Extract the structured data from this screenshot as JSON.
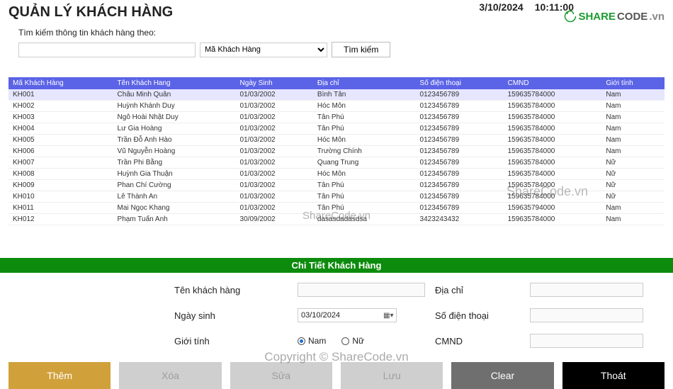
{
  "header": {
    "title": "QUẢN LÝ KHÁCH HÀNG",
    "date": "3/10/2024",
    "time": "10:11:00",
    "logo_share": "SHARE",
    "logo_code": "CODE",
    "logo_vn": ".vn"
  },
  "search": {
    "label": "Tìm kiếm thông tin khách hàng theo:",
    "filter_option": "Mã Khách Hàng",
    "button": "Tìm kiếm"
  },
  "table": {
    "headers": [
      "Mã Khách Hàng",
      "Tên Khách Hang",
      "Ngày Sinh",
      "Địa chỉ",
      "Số điện thoại",
      "CMND",
      "Giới tính"
    ],
    "rows": [
      {
        "id": "KH001",
        "name": "Châu Minh Quân",
        "dob": "01/03/2002",
        "addr": "Bình Tân",
        "phone": "0123456789",
        "cmnd": "159635784000",
        "sex": "Nam",
        "selected": true
      },
      {
        "id": "KH002",
        "name": "Huỳnh Khánh Duy",
        "dob": "01/03/2002",
        "addr": "Hóc Môn",
        "phone": "0123456789",
        "cmnd": "159635784000",
        "sex": "Nam"
      },
      {
        "id": "KH003",
        "name": "Ngô Hoài Nhật Duy",
        "dob": "01/03/2002",
        "addr": "Tân Phú",
        "phone": "0123456789",
        "cmnd": "159635784000",
        "sex": "Nam"
      },
      {
        "id": "KH004",
        "name": "Lư Gia Hoàng",
        "dob": "01/03/2002",
        "addr": "Tân Phú",
        "phone": "0123456789",
        "cmnd": "159635784000",
        "sex": "Nam"
      },
      {
        "id": "KH005",
        "name": "Trần Đỗ Anh Hào",
        "dob": "01/03/2002",
        "addr": "Hóc Môn",
        "phone": "0123456789",
        "cmnd": "159635784000",
        "sex": "Nam"
      },
      {
        "id": "KH006",
        "name": "Vũ Nguyễn Hoàng",
        "dob": "01/03/2002",
        "addr": "Trường Chính",
        "phone": "0123456789",
        "cmnd": "159635784000",
        "sex": "Nam"
      },
      {
        "id": "KH007",
        "name": "Trần Phi Bằng",
        "dob": "01/03/2002",
        "addr": "Quang Trung",
        "phone": "0123456789",
        "cmnd": "159635784000",
        "sex": "Nữ"
      },
      {
        "id": "KH008",
        "name": "Huỳnh Gia Thuận",
        "dob": "01/03/2002",
        "addr": "Hóc Môn",
        "phone": "0123456789",
        "cmnd": "159635784000",
        "sex": "Nữ"
      },
      {
        "id": "KH009",
        "name": "Phan Chí Cường",
        "dob": "01/03/2002",
        "addr": "Tân Phú",
        "phone": "0123456789",
        "cmnd": "159635784000",
        "sex": "Nữ"
      },
      {
        "id": "KH010",
        "name": "Lê Thành An",
        "dob": "01/03/2002",
        "addr": "Tân Phú",
        "phone": "0123456789",
        "cmnd": "159635784000",
        "sex": "Nữ"
      },
      {
        "id": "KH011",
        "name": "Mai Ngọc Khang",
        "dob": "01/03/2002",
        "addr": "Tân Phú",
        "phone": "0123456789",
        "cmnd": "159635794000",
        "sex": "Nam"
      },
      {
        "id": "KH012",
        "name": "Phạm Tuấn Anh",
        "dob": "30/09/2002",
        "addr": "dasasdadasdsa",
        "phone": "3423243432",
        "cmnd": "159635784000",
        "sex": "Nam"
      }
    ]
  },
  "detail": {
    "band": "Chi Tiết Khách Hàng",
    "labels": {
      "name": "Tên khách hàng",
      "addr": "Địa chỉ",
      "dob": "Ngày sinh",
      "phone": "Số điện thoại",
      "sex": "Giới tính",
      "cmnd": "CMND"
    },
    "dob_value": "03/10/2024",
    "sex_options": {
      "male": "Nam",
      "female": "Nữ"
    }
  },
  "buttons": {
    "add": "Thêm",
    "delete": "Xóa",
    "edit": "Sửa",
    "save": "Lưu",
    "clear": "Clear",
    "exit": "Thoát"
  },
  "watermarks": {
    "mid": "ShareCode.vn",
    "mid2": "ShareCode.vn",
    "copyright": "Copyright © ShareCode.vn"
  }
}
